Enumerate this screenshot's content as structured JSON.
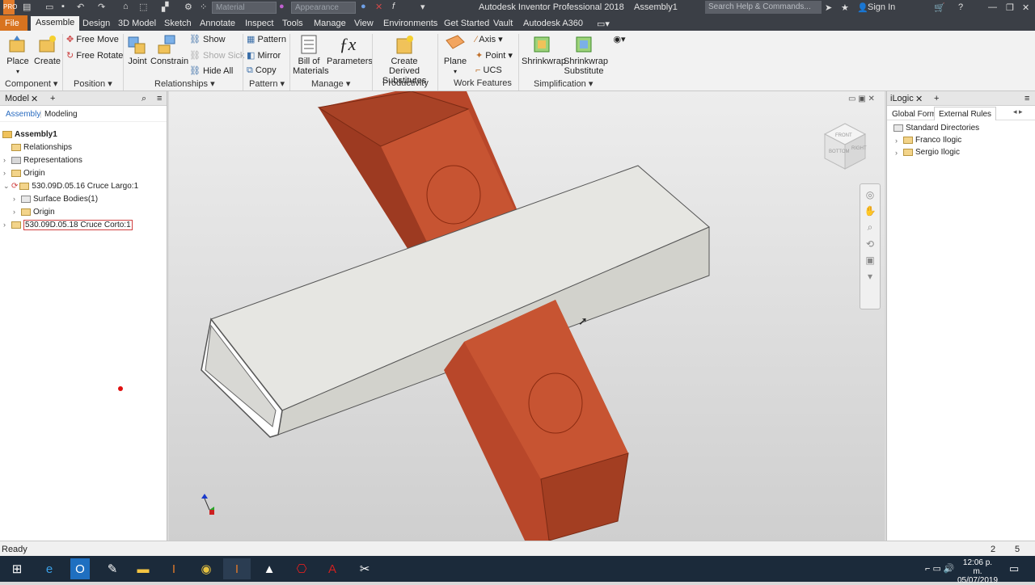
{
  "app": {
    "title": "Autodesk Inventor Professional 2018",
    "document": "Assembly1",
    "pro_badge": "PRO"
  },
  "quick_access": {
    "material": "Material",
    "appearance": "Appearance",
    "search_placeholder": "Search Help & Commands...",
    "sign_in": "Sign In"
  },
  "tabs": [
    "File",
    "Assemble",
    "Design",
    "3D Model",
    "Sketch",
    "Annotate",
    "Inspect",
    "Tools",
    "Manage",
    "View",
    "Environments",
    "Get Started",
    "Vault",
    "Autodesk A360"
  ],
  "ribbon": {
    "place": "Place",
    "create": "Create",
    "free_move": "Free Move",
    "free_rotate": "Free Rotate",
    "joint": "Joint",
    "constrain": "Constrain",
    "show": "Show",
    "show_sick": "Show Sick",
    "hide_all": "Hide All",
    "pattern": "Pattern",
    "mirror": "Mirror",
    "copy": "Copy",
    "bom_l1": "Bill of",
    "bom_l2": "Materials",
    "parameters": "Parameters",
    "derived_l1": "Create Derived",
    "derived_l2": "Substitutes",
    "plane": "Plane",
    "axis": "Axis",
    "point": "Point",
    "ucs": "UCS",
    "shrinkwrap": "Shrinkwrap",
    "shrink_sub_l1": "Shrinkwrap",
    "shrink_sub_l2": "Substitute",
    "groups": {
      "component": "Component",
      "position": "Position",
      "relationships": "Relationships",
      "pattern": "Pattern",
      "manage": "Manage",
      "productivity": "Productivity",
      "work_features": "Work Features",
      "simplification": "Simplification"
    }
  },
  "browser": {
    "tab": "Model",
    "sub_assembly": "Assembly",
    "sub_modeling": "Modeling",
    "root": "Assembly1",
    "items": [
      "Relationships",
      "Representations",
      "Origin",
      "530.09D.05.16 Cruce Largo:1",
      "Surface Bodies(1)",
      "Origin",
      "530.09D.05.18 Cruce Corto:1"
    ]
  },
  "ilogic": {
    "tab": "iLogic",
    "global_forms": "Global Forms",
    "external_rules": "External Rules",
    "standard_dirs": "Standard Directories",
    "items": [
      "Franco Ilogic",
      "Sergio Ilogic"
    ]
  },
  "viewcube": {
    "front": "FRONT",
    "right": "RIGHT",
    "bottom": "BOTTOM"
  },
  "status": {
    "left": "Ready",
    "n1": "2",
    "n2": "5"
  },
  "clock": {
    "time": "12:06 p. m.",
    "date": "05/07/2019"
  },
  "colors": {
    "accent": "#d8731f",
    "part_red": "#b8472a",
    "part_gray": "#dcdcd6"
  }
}
